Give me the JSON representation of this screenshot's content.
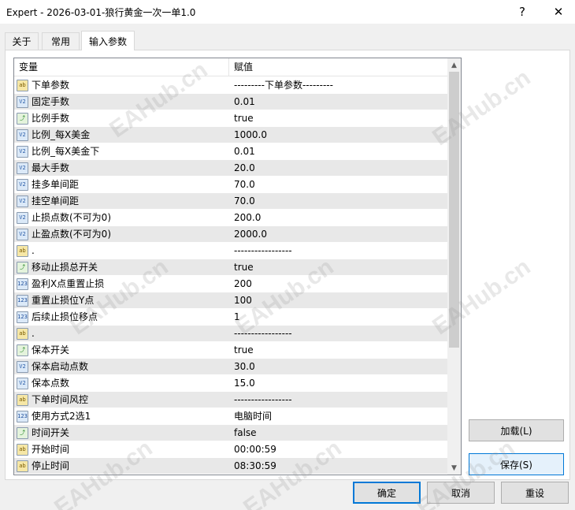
{
  "window": {
    "title": "Expert - 2026-03-01-狼行黄金一次一单1.0",
    "help_glyph": "?",
    "close_glyph": "✕"
  },
  "tabs": [
    {
      "label": "关于"
    },
    {
      "label": "常用"
    },
    {
      "label": "输入参数"
    }
  ],
  "table": {
    "col_variable": "变量",
    "col_value": "赋值",
    "rows": [
      {
        "icon": "ab",
        "type": "string",
        "name": "下单参数",
        "value": "---------下单参数---------"
      },
      {
        "icon": "V2",
        "type": "double",
        "name": "固定手数",
        "value": "0.01"
      },
      {
        "icon": "⤴",
        "type": "bool",
        "name": "比例手数",
        "value": "true"
      },
      {
        "icon": "V2",
        "type": "double",
        "name": "比例_每X美金",
        "value": "1000.0"
      },
      {
        "icon": "V2",
        "type": "double",
        "name": "比例_每X美金下",
        "value": "0.01"
      },
      {
        "icon": "V2",
        "type": "double",
        "name": "最大手数",
        "value": "20.0"
      },
      {
        "icon": "V2",
        "type": "double",
        "name": "挂多单间距",
        "value": "70.0"
      },
      {
        "icon": "V2",
        "type": "double",
        "name": "挂空单间距",
        "value": "70.0"
      },
      {
        "icon": "V2",
        "type": "double",
        "name": "止损点数(不可为0)",
        "value": "200.0"
      },
      {
        "icon": "V2",
        "type": "double",
        "name": "止盈点数(不可为0)",
        "value": "2000.0"
      },
      {
        "icon": "ab",
        "type": "string",
        "name": ".",
        "value": "-----------------"
      },
      {
        "icon": "⤴",
        "type": "bool",
        "name": "移动止损总开关",
        "value": "true"
      },
      {
        "icon": "123",
        "type": "int",
        "name": "盈利X点重置止损",
        "value": "200"
      },
      {
        "icon": "123",
        "type": "int",
        "name": "重置止损位Y点",
        "value": "100"
      },
      {
        "icon": "123",
        "type": "int",
        "name": "后续止损位移点",
        "value": "1"
      },
      {
        "icon": "ab",
        "type": "string",
        "name": ".",
        "value": "-----------------"
      },
      {
        "icon": "⤴",
        "type": "bool",
        "name": "保本开关",
        "value": "true"
      },
      {
        "icon": "V2",
        "type": "double",
        "name": "保本启动点数",
        "value": "30.0"
      },
      {
        "icon": "V2",
        "type": "double",
        "name": "保本点数",
        "value": "15.0"
      },
      {
        "icon": "ab",
        "type": "string",
        "name": "下单时间风控",
        "value": "-----------------"
      },
      {
        "icon": "123",
        "type": "int",
        "name": "使用方式2选1",
        "value": "电脑时间"
      },
      {
        "icon": "⤴",
        "type": "bool",
        "name": "时间开关",
        "value": "false"
      },
      {
        "icon": "ab",
        "type": "string",
        "name": "开始时间",
        "value": "00:00:59"
      },
      {
        "icon": "ab",
        "type": "string",
        "name": "停止时间",
        "value": "08:30:59"
      }
    ]
  },
  "scrollbar": {
    "up_glyph": "▲",
    "down_glyph": "▼"
  },
  "buttons": {
    "load": "加载(L)",
    "save": "保存(S)",
    "ok": "确定",
    "cancel": "取消",
    "reset": "重设"
  },
  "watermark": "EAHub.cn"
}
